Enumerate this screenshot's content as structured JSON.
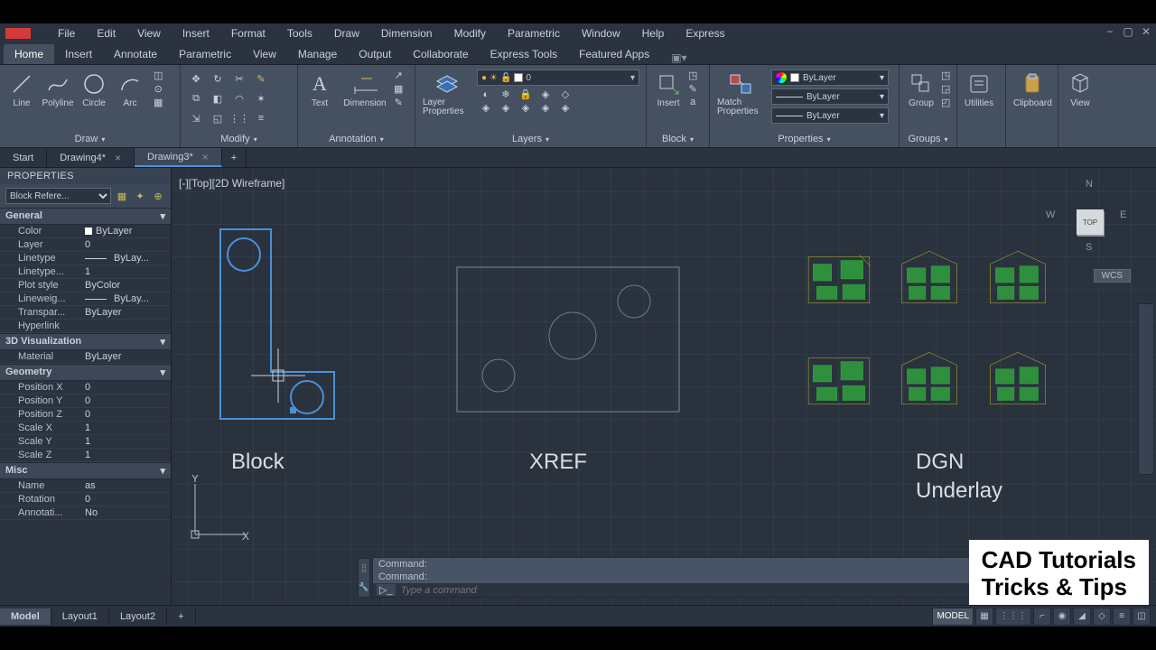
{
  "menubar": [
    "File",
    "Edit",
    "View",
    "Insert",
    "Format",
    "Tools",
    "Draw",
    "Dimension",
    "Modify",
    "Parametric",
    "Window",
    "Help",
    "Express"
  ],
  "ribbon_tabs": [
    "Home",
    "Insert",
    "Annotate",
    "Parametric",
    "View",
    "Manage",
    "Output",
    "Collaborate",
    "Express Tools",
    "Featured Apps"
  ],
  "active_ribbon_tab": "Home",
  "panels": {
    "draw": {
      "title": "Draw",
      "buttons": [
        "Line",
        "Polyline",
        "Circle",
        "Arc"
      ]
    },
    "modify": {
      "title": "Modify"
    },
    "annotation": {
      "title": "Annotation",
      "buttons": [
        "Text",
        "Dimension"
      ]
    },
    "layers": {
      "title": "Layers",
      "button": "Layer Properties",
      "current": "0"
    },
    "block": {
      "title": "Block",
      "button": "Insert"
    },
    "properties": {
      "title": "Properties",
      "button": "Match Properties",
      "color": "ByLayer",
      "ltype": "ByLayer",
      "lweight": "ByLayer"
    },
    "groups": {
      "title": "Groups",
      "button": "Group"
    },
    "utilities": {
      "title": "Utilities"
    },
    "clipboard": {
      "title": "Clipboard"
    },
    "view": {
      "title": "View"
    }
  },
  "file_tabs": [
    {
      "label": "Start",
      "closable": false
    },
    {
      "label": "Drawing4*",
      "closable": true
    },
    {
      "label": "Drawing3*",
      "closable": true,
      "active": true
    }
  ],
  "properties_panel": {
    "title": "PROPERTIES",
    "selector": "Block Refere...",
    "sections": [
      {
        "name": "General",
        "items": [
          {
            "k": "Color",
            "v": "ByLayer",
            "swatch": true
          },
          {
            "k": "Layer",
            "v": "0"
          },
          {
            "k": "Linetype",
            "v": "ByLay...",
            "line": true
          },
          {
            "k": "Linetype...",
            "v": "1"
          },
          {
            "k": "Plot style",
            "v": "ByColor"
          },
          {
            "k": "Lineweig...",
            "v": "ByLay...",
            "line": true
          },
          {
            "k": "Transpar...",
            "v": "ByLayer"
          },
          {
            "k": "Hyperlink",
            "v": ""
          }
        ]
      },
      {
        "name": "3D Visualization",
        "items": [
          {
            "k": "Material",
            "v": "ByLayer"
          }
        ]
      },
      {
        "name": "Geometry",
        "items": [
          {
            "k": "Position X",
            "v": "0"
          },
          {
            "k": "Position Y",
            "v": "0"
          },
          {
            "k": "Position Z",
            "v": "0"
          },
          {
            "k": "Scale X",
            "v": "1"
          },
          {
            "k": "Scale Y",
            "v": "1"
          },
          {
            "k": "Scale Z",
            "v": "1"
          }
        ]
      },
      {
        "name": "Misc",
        "items": [
          {
            "k": "Name",
            "v": "as"
          },
          {
            "k": "Rotation",
            "v": "0"
          },
          {
            "k": "Annotati...",
            "v": "No"
          }
        ]
      }
    ]
  },
  "viewport_label": "[-][Top][2D Wireframe]",
  "viewcube": {
    "face": "TOP",
    "n": "N",
    "s": "S",
    "e": "E",
    "w": "W"
  },
  "wcs_label": "WCS",
  "canvas_labels": {
    "block": "Block",
    "xref": "XREF",
    "dgn1": "DGN",
    "dgn2": "Underlay"
  },
  "ucs": {
    "x": "X",
    "y": "Y"
  },
  "command": {
    "hist1": "Command:",
    "hist2": "Command:",
    "placeholder": "Type a command",
    "arrow": "▸"
  },
  "overlay": {
    "l1": "CAD Tutorials",
    "l2": "Tricks & Tips"
  },
  "layout_tabs": [
    "Model",
    "Layout1",
    "Layout2"
  ],
  "status": {
    "model": "MODEL"
  }
}
